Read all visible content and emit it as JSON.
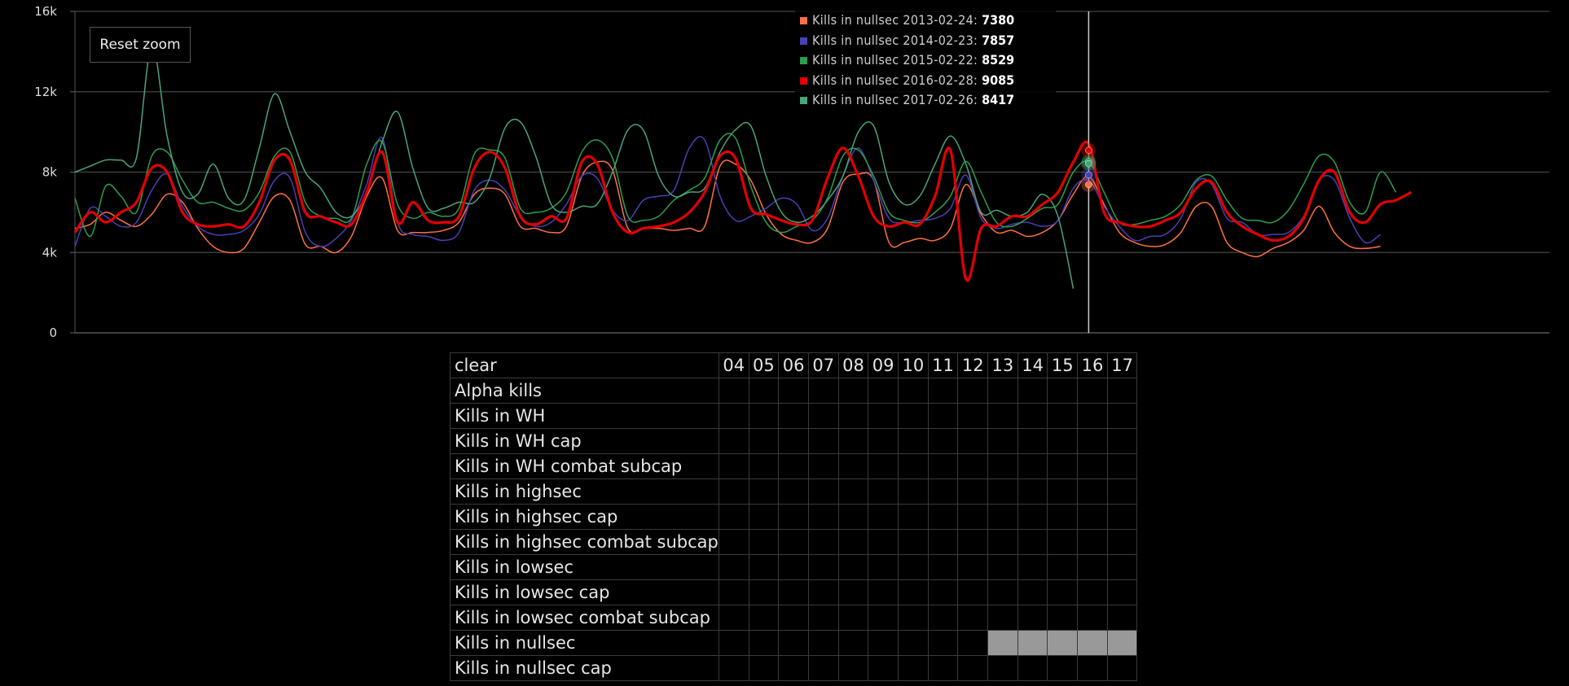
{
  "reset_zoom_label": "Reset zoom",
  "chart_data": {
    "type": "line",
    "ylim": [
      0,
      16000
    ],
    "y_ticks": [
      "0",
      "4k",
      "8k",
      "12k",
      "16k"
    ],
    "grid": true,
    "hover_week": 33,
    "x_range_weeks": [
      0,
      48
    ],
    "series": [
      {
        "name": "Kills in nullsec 2013-02-24",
        "color": "#ff7043",
        "values": [
          5200,
          5400,
          6000,
          5600,
          5300,
          5900,
          6900,
          6500,
          5200,
          4300,
          4000,
          4200,
          5500,
          6800,
          6600,
          4400,
          4300,
          4000,
          4800,
          6800,
          7700,
          5100,
          5000,
          5000,
          5100,
          5500,
          6900,
          7200,
          6900,
          5300,
          5200,
          5000,
          5300,
          7800,
          8500,
          8100,
          5200,
          5200,
          5200,
          5100,
          5200,
          5300,
          8300,
          8400,
          7600,
          5900,
          4900,
          4600,
          4500,
          5200,
          7500,
          7900,
          7600,
          4500,
          4500,
          4700,
          4600,
          5200,
          7380,
          5900,
          5000,
          5100,
          4800,
          5000,
          5600,
          6900,
          7800,
          6400,
          5000,
          4500,
          4300,
          4400,
          5000,
          6300,
          6300,
          4500,
          4000,
          3800,
          4200,
          4500,
          5100,
          6300,
          5000,
          4300,
          4200,
          4300
        ],
        "xstep": 0.5
      },
      {
        "name": "Kills in nullsec 2014-02-23",
        "color": "#4a3fb5",
        "values": [
          4300,
          6200,
          5800,
          5300,
          5500,
          7100,
          7900,
          6300,
          5300,
          4900,
          4900,
          5100,
          5900,
          7600,
          7700,
          5000,
          4300,
          4700,
          5600,
          7400,
          9700,
          5500,
          4900,
          4800,
          4600,
          5000,
          7100,
          7600,
          7100,
          5800,
          5300,
          5500,
          6400,
          7800,
          7700,
          6100,
          5600,
          6600,
          6800,
          7100,
          9200,
          9600,
          6800,
          5600,
          5800,
          6200,
          6700,
          6400,
          5100,
          5700,
          7800,
          9200,
          7600,
          5700,
          5500,
          5600,
          5700,
          6200,
          7857,
          5700,
          5200,
          5400,
          5500,
          5300,
          5600,
          7200,
          7600,
          6300,
          5300,
          4600,
          4800,
          4900,
          5700,
          7500,
          7400,
          5700,
          5500,
          4900,
          4900,
          5000,
          5800,
          7600,
          7600,
          5700,
          4500,
          4900
        ],
        "xstep": 0.5
      },
      {
        "name": "Kills in nullsec 2015-02-22",
        "color": "#2e9e4e",
        "values": [
          6700,
          4800,
          7300,
          6800,
          6000,
          8800,
          9000,
          7600,
          6500,
          6500,
          6200,
          6100,
          7000,
          8800,
          9000,
          6500,
          5800,
          5700,
          5700,
          8400,
          9500,
          6400,
          5700,
          6000,
          5800,
          6200,
          8900,
          9100,
          8700,
          6200,
          6000,
          6200,
          7000,
          9000,
          9600,
          8700,
          5800,
          5600,
          5800,
          6600,
          7100,
          7700,
          9600,
          9700,
          7300,
          5500,
          5000,
          5300,
          5600,
          6700,
          8800,
          9100,
          7800,
          6000,
          5600,
          5500,
          6000,
          6800,
          8529,
          7000,
          5500,
          5300,
          5700,
          6200,
          6400,
          8000,
          8500,
          7000,
          5500,
          5400,
          5600,
          5800,
          6400,
          7600,
          7800,
          6600,
          5700,
          5600,
          5500,
          6100,
          7400,
          8800,
          8500,
          6500,
          6000,
          8000,
          7000
        ],
        "xstep": 0.5
      },
      {
        "name": "Kills in nullsec 2016-02-28",
        "color": "#e30000",
        "bold": true,
        "values": [
          5000,
          6000,
          5500,
          6000,
          6500,
          8200,
          8000,
          6000,
          5400,
          5300,
          5400,
          5300,
          6500,
          8600,
          8600,
          6000,
          5800,
          5500,
          5400,
          7000,
          9000,
          5500,
          6500,
          5600,
          5500,
          5800,
          8200,
          9000,
          8200,
          5800,
          5400,
          5800,
          5700,
          8500,
          8400,
          6000,
          5000,
          5200,
          5300,
          5500,
          6000,
          7000,
          8800,
          8700,
          6200,
          5900,
          5600,
          5400,
          5600,
          7700,
          9200,
          7800,
          5800,
          5300,
          5500,
          5400,
          6800,
          9085,
          2700,
          5200,
          5300,
          5800,
          5800,
          6400,
          7000,
          8500,
          9400,
          6000,
          5500,
          5300,
          5300,
          5600,
          6000,
          7200,
          7500,
          6000,
          5300,
          4900,
          4600,
          4800,
          5700,
          7600,
          8000,
          6000,
          5500,
          6400,
          6600,
          7000
        ],
        "xstep": 0.5
      },
      {
        "name": "Kills in nullsec 2017-02-26",
        "color": "#4aa37a",
        "values": [
          8000,
          8300,
          8600,
          8600,
          8700,
          14300,
          9800,
          7000,
          6900,
          8400,
          6700,
          6600,
          9200,
          11900,
          10000,
          8000,
          7200,
          6000,
          5800,
          7000,
          9500,
          11000,
          8200,
          6200,
          6200,
          6500,
          6500,
          7700,
          10200,
          10500,
          8800,
          6400,
          6000,
          6300,
          6400,
          8000,
          10100,
          10100,
          7800,
          6800,
          7000,
          7200,
          9000,
          10100,
          10300,
          7800,
          6000,
          5500,
          5800,
          6600,
          7800,
          10000,
          10300,
          7500,
          6400,
          6800,
          8400,
          9800,
          8417,
          6000,
          6100,
          5800,
          6000,
          6900,
          5800,
          2200
        ],
        "xstep": 0.5,
        "lengthNote": ""
      }
    ]
  },
  "tooltip": [
    {
      "label": "Kills in nullsec 2013-02-24: ",
      "value": "7380",
      "color": "#ff7043"
    },
    {
      "label": "Kills in nullsec 2014-02-23: ",
      "value": "7857",
      "color": "#4a3fb5"
    },
    {
      "label": "Kills in nullsec 2015-02-22: ",
      "value": "8529",
      "color": "#2e9e4e"
    },
    {
      "label": "Kills in nullsec 2016-02-28: ",
      "value": "9085",
      "color": "#e30000"
    },
    {
      "label": "Kills in nullsec 2017-02-26: ",
      "value": "8417",
      "color": "#4aa37a"
    }
  ],
  "table": {
    "header_label": "clear",
    "years": [
      "04",
      "05",
      "06",
      "07",
      "08",
      "09",
      "10",
      "11",
      "12",
      "13",
      "14",
      "15",
      "16",
      "17"
    ],
    "rows": [
      {
        "label": "Alpha kills",
        "on": []
      },
      {
        "label": "Kills in WH",
        "on": []
      },
      {
        "label": "Kills in WH cap",
        "on": []
      },
      {
        "label": "Kills in WH combat subcap",
        "on": []
      },
      {
        "label": "Kills in highsec",
        "on": []
      },
      {
        "label": "Kills in highsec cap",
        "on": []
      },
      {
        "label": "Kills in highsec combat subcap",
        "on": []
      },
      {
        "label": "Kills in lowsec",
        "on": []
      },
      {
        "label": "Kills in lowsec cap",
        "on": []
      },
      {
        "label": "Kills in lowsec combat subcap",
        "on": []
      },
      {
        "label": "Kills in nullsec",
        "on": [
          "13",
          "14",
          "15",
          "16",
          "17"
        ]
      },
      {
        "label": "Kills in nullsec cap",
        "on": []
      }
    ]
  }
}
